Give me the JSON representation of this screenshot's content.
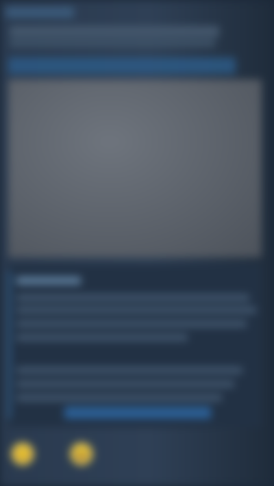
{
  "header": {
    "tag": "",
    "line1": "",
    "line2": ""
  },
  "band": {
    "label": ""
  },
  "screenshot": {
    "caption": ""
  },
  "review": {
    "title": "",
    "link_label": ""
  },
  "reactions": [
    {
      "icon": "smile-icon",
      "glyph": "😊",
      "count": ""
    },
    {
      "icon": "laugh-icon",
      "glyph": "😆",
      "count": ""
    }
  ],
  "colors": {
    "background": "#1b2838",
    "accent": "#2c5d8a",
    "link": "#2b5e93",
    "emoji": "#c6b35a"
  }
}
